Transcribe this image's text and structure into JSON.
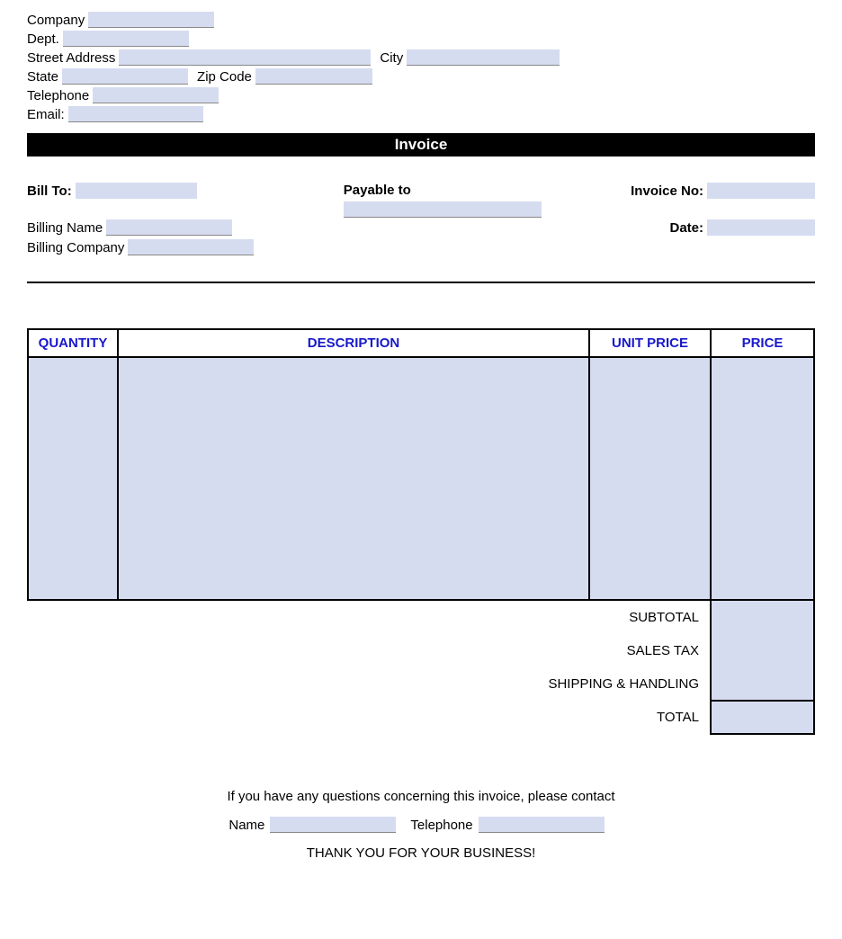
{
  "header": {
    "company_label": "Company",
    "dept_label": "Dept.",
    "street_label": "Street Address",
    "city_label": "City",
    "state_label": "State",
    "zip_label": "Zip Code",
    "telephone_label": "Telephone",
    "email_label": "Email:"
  },
  "title": "Invoice",
  "billing": {
    "bill_to_label": "Bill To:",
    "billing_name_label": "Billing Name",
    "billing_company_label": "Billing Company",
    "payable_to_label": "Payable to",
    "invoice_no_label": "Invoice No:",
    "date_label": "Date:"
  },
  "table": {
    "headers": {
      "quantity": "QUANTITY",
      "description": "DESCRIPTION",
      "unit_price": "UNIT PRICE",
      "price": "PRICE"
    }
  },
  "totals": {
    "subtotal": "SUBTOTAL",
    "sales_tax": "SALES TAX",
    "shipping": "SHIPPING & HANDLING",
    "total": "TOTAL"
  },
  "footer": {
    "questions": "If you have any questions concerning this invoice, please contact",
    "name_label": "Name",
    "telephone_label": "Telephone",
    "thanks": "THANK YOU FOR YOUR BUSINESS!"
  }
}
